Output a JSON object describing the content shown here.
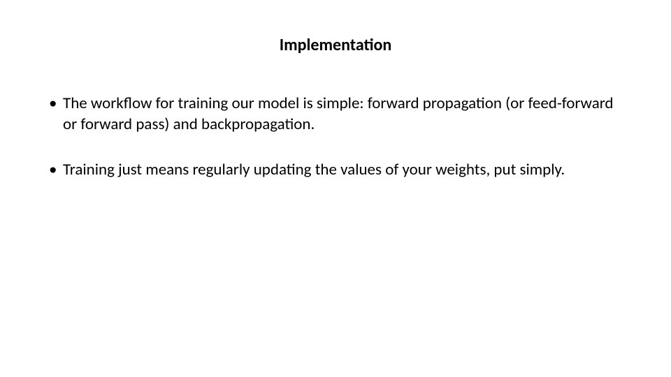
{
  "slide": {
    "title": "Implementation",
    "bullets": [
      "The workflow for training our model is simple: forward propagation (or feed-forward or forward pass) and backpropagation.",
      "Training just means regularly updating the values of your weights, put simply."
    ]
  }
}
